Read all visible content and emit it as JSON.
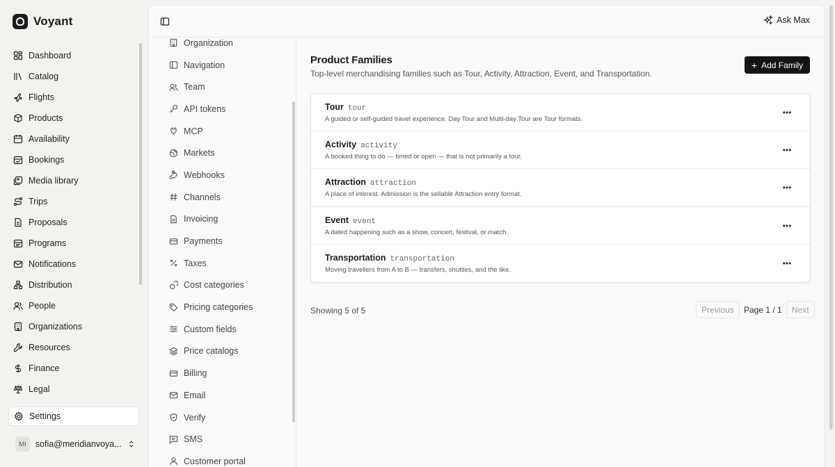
{
  "app": {
    "name": "Voyant"
  },
  "nav": {
    "items": [
      {
        "label": "Dashboard",
        "icon": "dashboard-icon"
      },
      {
        "label": "Catalog",
        "icon": "catalog-icon"
      },
      {
        "label": "Flights",
        "icon": "plane-icon"
      },
      {
        "label": "Products",
        "icon": "package-icon"
      },
      {
        "label": "Availability",
        "icon": "calendar-icon"
      },
      {
        "label": "Bookings",
        "icon": "calendar-check-icon"
      },
      {
        "label": "Media library",
        "icon": "image-icon"
      },
      {
        "label": "Trips",
        "icon": "route-icon"
      },
      {
        "label": "Proposals",
        "icon": "document-icon"
      },
      {
        "label": "Programs",
        "icon": "calendar-range-icon"
      },
      {
        "label": "Notifications",
        "icon": "mail-icon"
      },
      {
        "label": "Distribution",
        "icon": "network-icon"
      },
      {
        "label": "People",
        "icon": "users-icon"
      },
      {
        "label": "Organizations",
        "icon": "building-icon"
      },
      {
        "label": "Resources",
        "icon": "wrench-icon"
      },
      {
        "label": "Finance",
        "icon": "dollar-icon"
      },
      {
        "label": "Legal",
        "icon": "scale-icon"
      }
    ],
    "settings_label": "Settings"
  },
  "user": {
    "initials": "MI",
    "email": "sofia@meridianvoya..."
  },
  "topbar": {
    "ask_label": "Ask Max"
  },
  "subnav": {
    "items": [
      {
        "label": "Organization",
        "icon": "building-icon"
      },
      {
        "label": "Navigation",
        "icon": "sidebar-icon"
      },
      {
        "label": "Team",
        "icon": "users-icon"
      },
      {
        "label": "API tokens",
        "icon": "key-icon"
      },
      {
        "label": "MCP",
        "icon": "plug-icon"
      },
      {
        "label": "Markets",
        "icon": "globe-icon"
      },
      {
        "label": "Webhooks",
        "icon": "webhook-icon"
      },
      {
        "label": "Channels",
        "icon": "hash-icon"
      },
      {
        "label": "Invoicing",
        "icon": "document-icon"
      },
      {
        "label": "Payments",
        "icon": "credit-card-icon"
      },
      {
        "label": "Taxes",
        "icon": "percent-icon"
      },
      {
        "label": "Cost categories",
        "icon": "coins-icon"
      },
      {
        "label": "Pricing categories",
        "icon": "tag-icon"
      },
      {
        "label": "Custom fields",
        "icon": "sliders-icon"
      },
      {
        "label": "Price catalogs",
        "icon": "layers-icon"
      },
      {
        "label": "Billing",
        "icon": "credit-card-icon"
      },
      {
        "label": "Email",
        "icon": "mail-icon"
      },
      {
        "label": "Verify",
        "icon": "shield-check-icon"
      },
      {
        "label": "SMS",
        "icon": "message-icon"
      },
      {
        "label": "Customer portal",
        "icon": "user-icon"
      }
    ]
  },
  "page": {
    "title": "Product Families",
    "subtitle": "Top-level merchandising families such as Tour, Activity, Attraction, Event, and Transportation.",
    "add_label": "Add Family"
  },
  "families": [
    {
      "name": "Tour",
      "code": "tour",
      "description": "A guided or self-guided travel experience. Day Tour and Multi-day Tour are Tour formats."
    },
    {
      "name": "Activity",
      "code": "activity",
      "description": "A booked thing to do — timed or open — that is not primarily a tour."
    },
    {
      "name": "Attraction",
      "code": "attraction",
      "description": "A place of interest. Admission is the sellable Attraction entry format."
    },
    {
      "name": "Event",
      "code": "event",
      "description": "A dated happening such as a show, concert, festival, or match."
    },
    {
      "name": "Transportation",
      "code": "transportation",
      "description": "Moving travellers from A to B — transfers, shuttles, and the like."
    }
  ],
  "pagination": {
    "showing": "Showing 5 of 5",
    "previous": "Previous",
    "page": "Page 1 / 1",
    "next": "Next"
  }
}
